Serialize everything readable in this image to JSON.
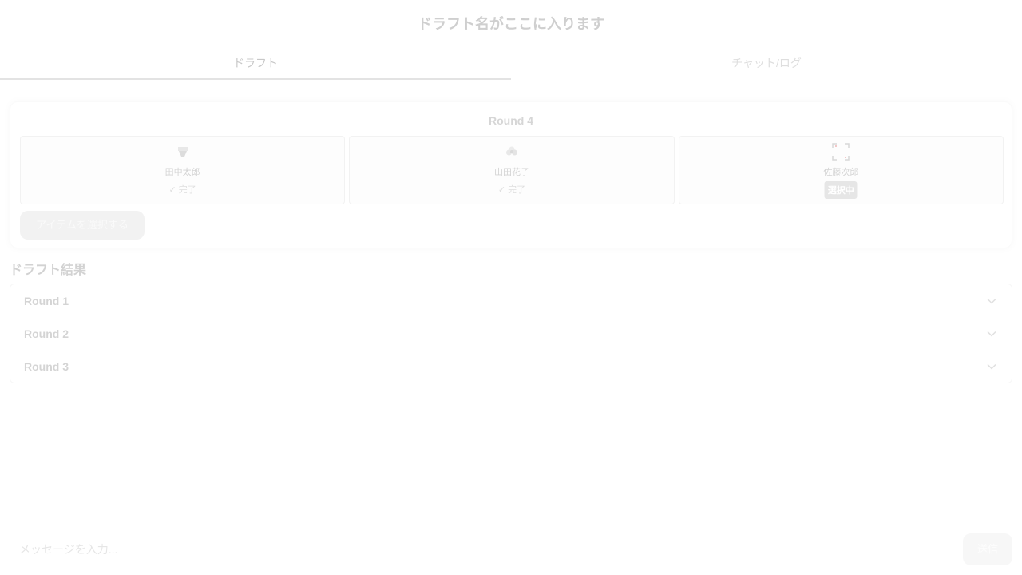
{
  "header": {
    "title": "ドラフト名がここに入ります"
  },
  "tabs": [
    {
      "label": "ドラフト",
      "active": true
    },
    {
      "label": "チャット/ログ",
      "active": false
    }
  ],
  "current_round": {
    "title": "Round 4",
    "players": [
      {
        "name": "田中太郎",
        "icon": "cake-icon",
        "status": "✓ 完了",
        "state": "done"
      },
      {
        "name": "山田花子",
        "icon": "flower-icon",
        "status": "✓ 完了",
        "state": "done"
      },
      {
        "name": "佐藤次郎",
        "icon": "target-icon",
        "status": "選択中",
        "state": "selecting"
      }
    ],
    "select_button": "アイテムを選択する"
  },
  "results": {
    "heading": "ドラフト結果",
    "rounds": [
      "Round 1",
      "Round 2",
      "Round 3"
    ]
  },
  "chat": {
    "placeholder": "メッセージを入力...",
    "send_label": "送信"
  },
  "colors": {
    "selecting_badge": "#e6e6e6",
    "target_icon_accent": "#f0b6b6"
  }
}
